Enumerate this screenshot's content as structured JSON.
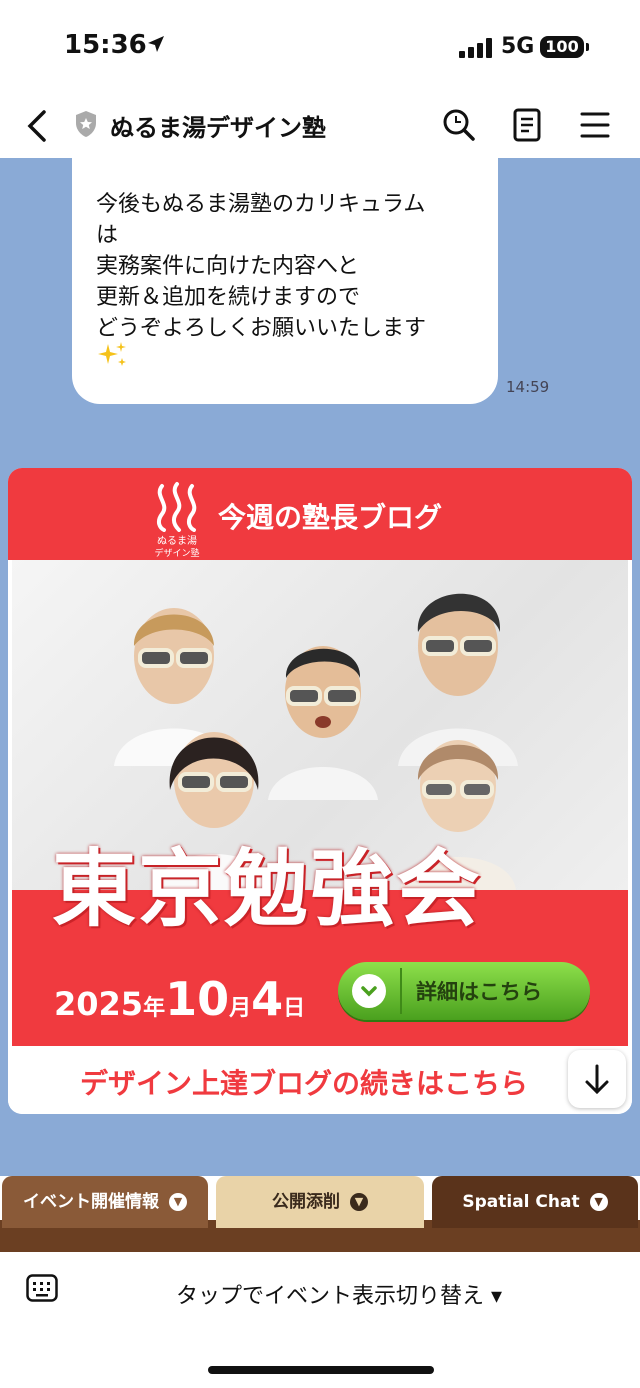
{
  "status_bar": {
    "time": "15:36",
    "network": "5G",
    "battery": "100"
  },
  "header": {
    "title": "ぬるま湯デザイン塾"
  },
  "message": {
    "lines": [
      "今後もぬるま湯塾のカリキュラム",
      "は",
      "実務案件に向けた内容へと",
      "更新＆追加を続けますので",
      "どうぞよろしくお願いいたします"
    ],
    "emoji": "✨",
    "time": "14:59"
  },
  "card": {
    "logo_line1": "ぬるま湯",
    "logo_line2": "デザイン塾",
    "blog_title": "今週の塾長ブログ",
    "event_title": "東京勉強会",
    "date_year": "2025",
    "date_year_unit": "年",
    "date_month": "10",
    "date_month_unit": "月",
    "date_day": "4",
    "date_day_unit": "日",
    "detail_button": "詳細はこちら",
    "continue_link": "デザイン上達ブログの続きはこちら"
  },
  "rich_menu": {
    "tabs": [
      {
        "label": "イベント開催情報"
      },
      {
        "label": "公開添削"
      },
      {
        "label": "Spatial Chat"
      }
    ]
  },
  "bottom_bar": {
    "switch_label": "タップでイベント表示切り替え ▾"
  },
  "colors": {
    "chat_bg": "#8aaad6",
    "brand_red": "#f03a3f",
    "button_green": "#5fb52a",
    "wood": "#6b3f22"
  }
}
